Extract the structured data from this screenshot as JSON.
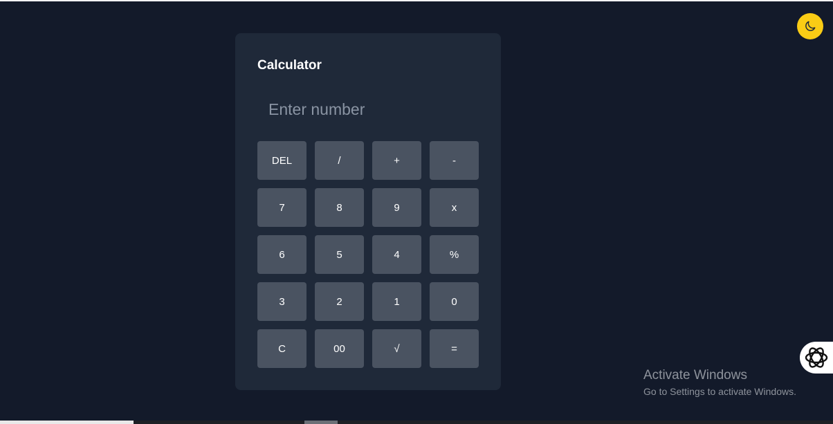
{
  "calculator": {
    "title": "Calculator",
    "display": {
      "value": "",
      "placeholder": "Enter number"
    },
    "keys": [
      [
        "DEL",
        "/",
        "+",
        "-"
      ],
      [
        "7",
        "8",
        "9",
        "x"
      ],
      [
        "6",
        "5",
        "4",
        "%"
      ],
      [
        "3",
        "2",
        "1",
        "0"
      ],
      [
        "C",
        "00",
        "√",
        "="
      ]
    ]
  },
  "theme_toggle": {
    "icon": "moon-icon",
    "color": "#facc15"
  },
  "side_widget": {
    "icon": "assistant-logo-icon"
  },
  "watermark": {
    "title": "Activate Windows",
    "subtitle": "Go to Settings to activate Windows."
  },
  "colors": {
    "background": "#131a2a",
    "panel": "#1f2939",
    "key": "#4a5361",
    "accent": "#facc15"
  }
}
